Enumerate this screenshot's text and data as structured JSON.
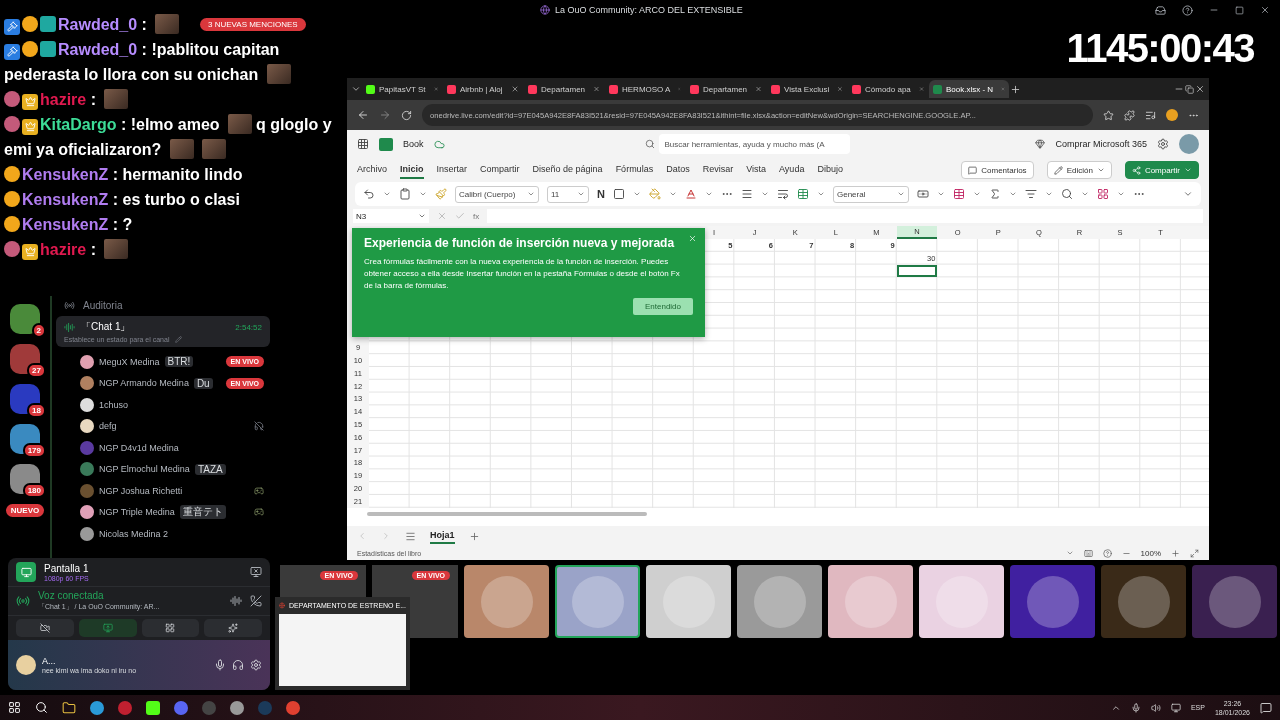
{
  "window": {
    "title": "La OuO Community: ARCO DEL EXTENSIBLE"
  },
  "timer": "1145:00:43",
  "chat": {
    "mentions_pill": "3 NUEVAS MENCIONES",
    "messages": [
      {
        "badges": [
          {
            "kind": "mod"
          },
          {
            "kind": "sub"
          },
          {
            "kind": "gg"
          }
        ],
        "name": "Rawded_0",
        "color": "#b68cff",
        "separator": ":",
        "parts": [
          {
            "kind": "emote"
          }
        ]
      },
      {
        "badges": [
          {
            "kind": "mod"
          },
          {
            "kind": "sub"
          },
          {
            "kind": "gg"
          }
        ],
        "name": "Rawded_0",
        "color": "#b68cff",
        "separator": ":",
        "parts": [
          {
            "kind": "text",
            "text": "!pablitou capitan pederasta lo llora con su onichan"
          },
          {
            "kind": "emote"
          }
        ]
      },
      {
        "badges": [
          {
            "kind": "avatar"
          },
          {
            "kind": "crown"
          }
        ],
        "name": "hazire",
        "color": "#e0194f",
        "separator": ":",
        "parts": [
          {
            "kind": "emote"
          }
        ]
      },
      {
        "badges": [
          {
            "kind": "avatar"
          },
          {
            "kind": "crown"
          }
        ],
        "name": "KitaDargo",
        "color": "#3ddc97",
        "separator": ":",
        "parts": [
          {
            "kind": "text",
            "text": "!elmo ameo"
          },
          {
            "kind": "emote"
          },
          {
            "kind": "text",
            "text": "q gloglo y emi ya oficializaron?"
          },
          {
            "kind": "emote"
          },
          {
            "kind": "emote"
          }
        ]
      },
      {
        "badges": [
          {
            "kind": "sub"
          }
        ],
        "name": "KensukenZ",
        "color": "#b07cf0",
        "separator": ":",
        "parts": [
          {
            "kind": "text",
            "text": "hermanito lindo"
          }
        ]
      },
      {
        "badges": [
          {
            "kind": "sub"
          }
        ],
        "name": "KensukenZ",
        "color": "#b07cf0",
        "separator": ":",
        "parts": [
          {
            "kind": "text",
            "text": "es turbo o clasi"
          }
        ]
      },
      {
        "badges": [
          {
            "kind": "sub"
          }
        ],
        "name": "KensukenZ",
        "color": "#b07cf0",
        "separator": ":",
        "parts": [
          {
            "kind": "text",
            "text": "?"
          }
        ]
      },
      {
        "badges": [
          {
            "kind": "avatar"
          },
          {
            "kind": "crown"
          }
        ],
        "name": "hazire",
        "color": "#e0194f",
        "separator": ":",
        "parts": [
          {
            "kind": "emote"
          }
        ]
      }
    ]
  },
  "rail": [
    {
      "badge": "2"
    },
    {
      "badge": "27"
    },
    {
      "badge": "18"
    },
    {
      "badge": "179"
    },
    {
      "badge": "180"
    },
    {
      "label": "NUEVO"
    }
  ],
  "channels": {
    "voice_channel": "Auditoria",
    "active": {
      "name": "「Chat 1」",
      "time": "2:54:52",
      "hint": "Establece un estado para el canal"
    },
    "members": [
      {
        "name": "MeguX Medina",
        "tag": "BTR!",
        "live": "EN VIVO",
        "deafened": false,
        "activity": false
      },
      {
        "name": "NGP Armando Medina",
        "tag": "Du",
        "live": "EN VIVO",
        "deafened": false,
        "activity": false
      },
      {
        "name": "1chuso",
        "deafened": false,
        "activity": false
      },
      {
        "name": "defg",
        "deafened": true,
        "activity": false
      },
      {
        "name": "NGP D4v1d Medina",
        "deafened": false,
        "activity": false
      },
      {
        "name": "NGP Elmochul Medina",
        "tag": "TAZA",
        "deafened": false,
        "activity": false
      },
      {
        "name": "NGP Joshua Richetti",
        "deafened": false,
        "activity": true
      },
      {
        "name": "NGP Triple Medina",
        "tag": "重音テト",
        "deafened": false,
        "activity": true
      },
      {
        "name": "Nicolas Medina 2",
        "deafened": false,
        "activity": false
      }
    ]
  },
  "panel": {
    "stream": {
      "title": "Pantalla 1",
      "quality": "1080p 60 FPS"
    },
    "voice": {
      "status": "Voz conectada",
      "channel": "「Chat 1」",
      "server": "/ La OuO Community: AR..."
    },
    "user": {
      "name": "A...",
      "status": "nee kimi wa ima doko ni iru no"
    }
  },
  "browser": {
    "tabs": [
      {
        "kind": "kick",
        "title": "PapitasVT St",
        "selected": false
      },
      {
        "kind": "airbnb",
        "title": "Airbnb | Aloj",
        "selected": false
      },
      {
        "kind": "airbnb",
        "title": "Departamen",
        "selected": false
      },
      {
        "kind": "airbnb",
        "title": "HERMOSO A",
        "selected": false
      },
      {
        "kind": "airbnb",
        "title": "Departamen",
        "selected": false
      },
      {
        "kind": "airbnb",
        "title": "Vista Exclusi",
        "selected": false
      },
      {
        "kind": "airbnb",
        "title": "Cómodo apa",
        "selected": false
      },
      {
        "kind": "excel",
        "title": "Book.xlsx - N",
        "selected": true
      }
    ],
    "url": "onedrive.live.com/edit?id=97E045A942E8FA83I521&resid=97E045A942E8FA83I521&ithint=file.xlsx&action=editNew&wdOrigin=SEARCHENGINE.GOOGLE.AP..."
  },
  "excel": {
    "file": "Book",
    "search": {
      "placeholder": "Buscar herramientas, ayuda y mucho más (A"
    },
    "buy": "Comprar Microsoft 365",
    "ribbon_tabs": [
      {
        "label": "Archivo",
        "selected": false
      },
      {
        "label": "Inicio",
        "selected": true
      },
      {
        "label": "Insertar",
        "selected": false
      },
      {
        "label": "Compartir",
        "selected": false
      },
      {
        "label": "Diseño de página",
        "selected": false
      },
      {
        "label": "Fórmulas",
        "selected": false
      },
      {
        "label": "Datos",
        "selected": false
      },
      {
        "label": "Revisar",
        "selected": false
      },
      {
        "label": "Vista",
        "selected": false
      },
      {
        "label": "Ayuda",
        "selected": false
      },
      {
        "label": "Dibujo",
        "selected": false
      }
    ],
    "comments": "Comentarios",
    "editing": "Edición",
    "share": "Compartir",
    "font": "Calibri (Cuerpo)",
    "font_size": "11",
    "bold": "N",
    "number_format": "General",
    "name_box": "N3",
    "fx": "fx",
    "popup": {
      "title": "Experiencia de función de inserción nueva y mejorada",
      "body": "Crea fórmulas fácilmente con la nueva experiencia de la función de inserción. Puedes obtener acceso a ella desde Insertar función en la pestaña Fórmulas o desde el botón Fx de la barra de fórmulas.",
      "button": "Entendido"
    },
    "columns": [
      {
        "label": "I",
        "selected": false,
        "row_1": "5"
      },
      {
        "label": "J",
        "selected": false,
        "row_1": "6"
      },
      {
        "label": "K",
        "selected": false,
        "row_1": "7"
      },
      {
        "label": "L",
        "selected": false,
        "row_1": "8"
      },
      {
        "label": "M",
        "selected": false,
        "row_1": "9"
      },
      {
        "label": "N",
        "selected": true,
        "row_2": "30"
      },
      {
        "label": "O",
        "selected": false
      },
      {
        "label": "P",
        "selected": false
      },
      {
        "label": "Q",
        "selected": false
      },
      {
        "label": "R",
        "selected": false
      },
      {
        "label": "S",
        "selected": false
      },
      {
        "label": "T",
        "selected": false
      }
    ],
    "visible_rows": [
      "9",
      "10",
      "11",
      "12",
      "13",
      "14",
      "15",
      "16",
      "17",
      "18",
      "19",
      "20",
      "21"
    ],
    "sheets": [
      {
        "name": "Hoja1",
        "selected": true
      }
    ],
    "status": "Estadísticas del libro",
    "zoom": "100%"
  },
  "tiles": [
    {
      "kind": "screen",
      "live": "EN VIVO",
      "selected": false
    },
    {
      "kind": "screen",
      "live": "EN VIVO",
      "selected": false
    },
    {
      "kind": "avatar",
      "color": "#b9876a",
      "selected": false
    },
    {
      "kind": "avatar",
      "color": "#9aa3c8",
      "selected": true
    },
    {
      "kind": "avatar",
      "color": "#cfcfcf",
      "selected": false
    },
    {
      "kind": "avatar",
      "color": "#9a9a9a",
      "selected": false
    },
    {
      "kind": "avatar",
      "color": "#e0b8c0",
      "selected": false
    },
    {
      "kind": "avatar",
      "color": "#ead2e2",
      "selected": false
    },
    {
      "kind": "avatar",
      "color": "#4020a0",
      "selected": false
    },
    {
      "kind": "avatar",
      "color": "#3a2a18",
      "selected": false
    },
    {
      "kind": "avatar",
      "color": "#3a2050",
      "selected": false
    }
  ],
  "hover_preview": {
    "title": "DEPARTAMENTO DE ESTRENO E..."
  },
  "taskbar": {
    "apps": [
      {
        "kind": "explorer"
      },
      {
        "kind": "edge"
      },
      {
        "kind": "red"
      },
      {
        "kind": "kick"
      },
      {
        "kind": "discord"
      },
      {
        "kind": "obs"
      },
      {
        "kind": "sound"
      },
      {
        "kind": "steam"
      },
      {
        "kind": "chrome"
      }
    ],
    "language": "ESP",
    "time": "23:26",
    "date": "18/01/2026"
  }
}
